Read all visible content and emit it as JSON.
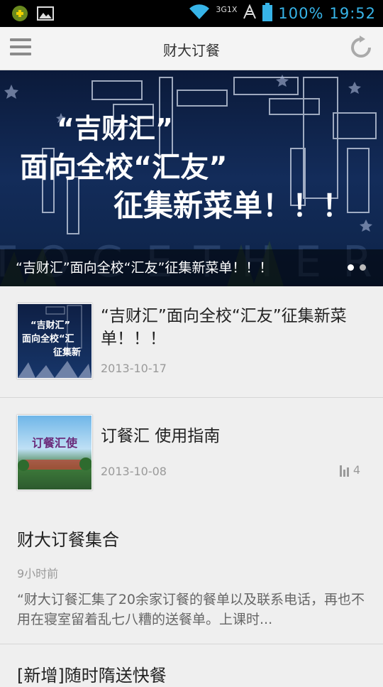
{
  "status_bar": {
    "battery": "100%",
    "time": "19:52",
    "network": "3G1X"
  },
  "action_bar": {
    "title": "财大订餐"
  },
  "banner": {
    "caption": "“吉财汇”面向全校“汇友”征集新菜单！！！",
    "art_lines": [
      "“吉财汇”",
      "面向全校“汇友”",
      "征集新菜单！！！"
    ],
    "background_text": "TOGETHER",
    "pages": 2,
    "active_page": 1
  },
  "articles": [
    {
      "title": "“吉财汇”面向全校“汇友”征集新菜单！！！",
      "date": "2013-10-17",
      "thumb_lines": [
        "“吉财汇”",
        "面向全校“汇",
        "征集新"
      ]
    },
    {
      "title": "订餐汇 使用指南",
      "date": "2013-10-08",
      "views": "4",
      "thumb_text": "订餐汇使"
    }
  ],
  "posts": [
    {
      "title": "财大订餐集合",
      "time": "9小时前",
      "summary": "“财大订餐汇集了20余家订餐的餐单以及联系电话，再也不用在寝室留着乱七八糟的送餐单。上课时..."
    },
    {
      "title": "[新增]随时隋送快餐"
    }
  ],
  "colors": {
    "accent": "#37b4e8",
    "banner_bg": "#132c5a"
  }
}
